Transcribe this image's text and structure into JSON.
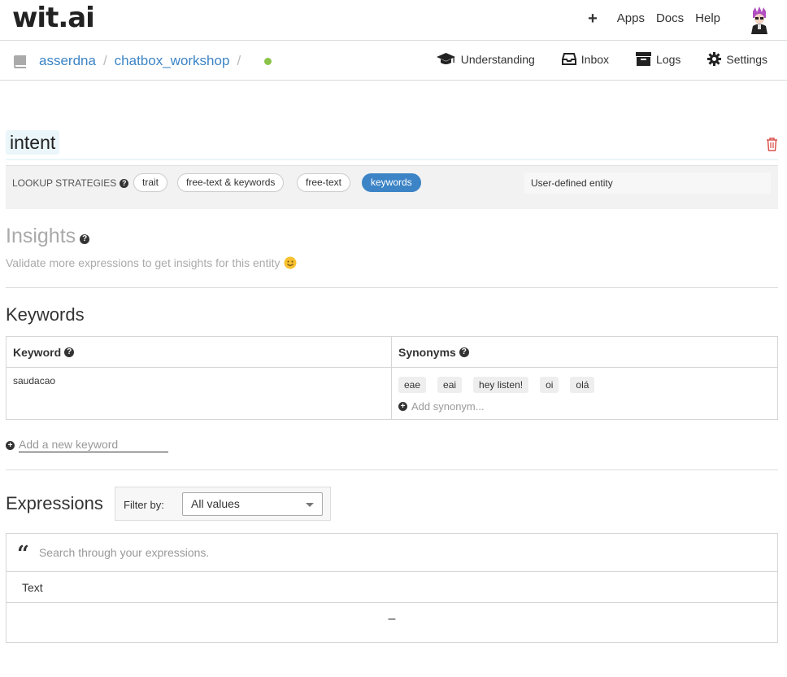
{
  "header": {
    "logo": "wit.ai",
    "nav": [
      "Apps",
      "Docs",
      "Help"
    ]
  },
  "breadcrumb": {
    "user": "asserdna",
    "app": "chatbox_workshop",
    "separator": "/"
  },
  "app_nav": {
    "understanding": "Understanding",
    "inbox": "Inbox",
    "logs": "Logs",
    "settings": "Settings"
  },
  "entity": {
    "name": "intent"
  },
  "lookup": {
    "label": "LOOKUP STRATEGIES",
    "strategies": [
      "trait",
      "free-text & keywords",
      "free-text",
      "keywords"
    ],
    "active": "keywords",
    "entity_type": "User-defined entity"
  },
  "insights": {
    "title": "Insights",
    "message": "Validate more expressions to get insights for this entity"
  },
  "keywords": {
    "title": "Keywords",
    "col_keyword": "Keyword",
    "col_synonyms": "Synonyms",
    "rows": [
      {
        "keyword": "saudacao",
        "synonyms": [
          "eae",
          "eai",
          "hey listen!",
          "oi",
          "olá"
        ]
      }
    ],
    "add_synonym": "Add synonym...",
    "add_keyword_placeholder": "Add a new keyword"
  },
  "expressions": {
    "title": "Expressions",
    "filter_label": "Filter by:",
    "filter_value": "All values",
    "search_placeholder": "Search through your expressions.",
    "col_text": "Text",
    "empty": "–"
  },
  "colors": {
    "link": "#3c84c6",
    "status_dot": "#8bc34a",
    "delete": "#d9534f"
  }
}
